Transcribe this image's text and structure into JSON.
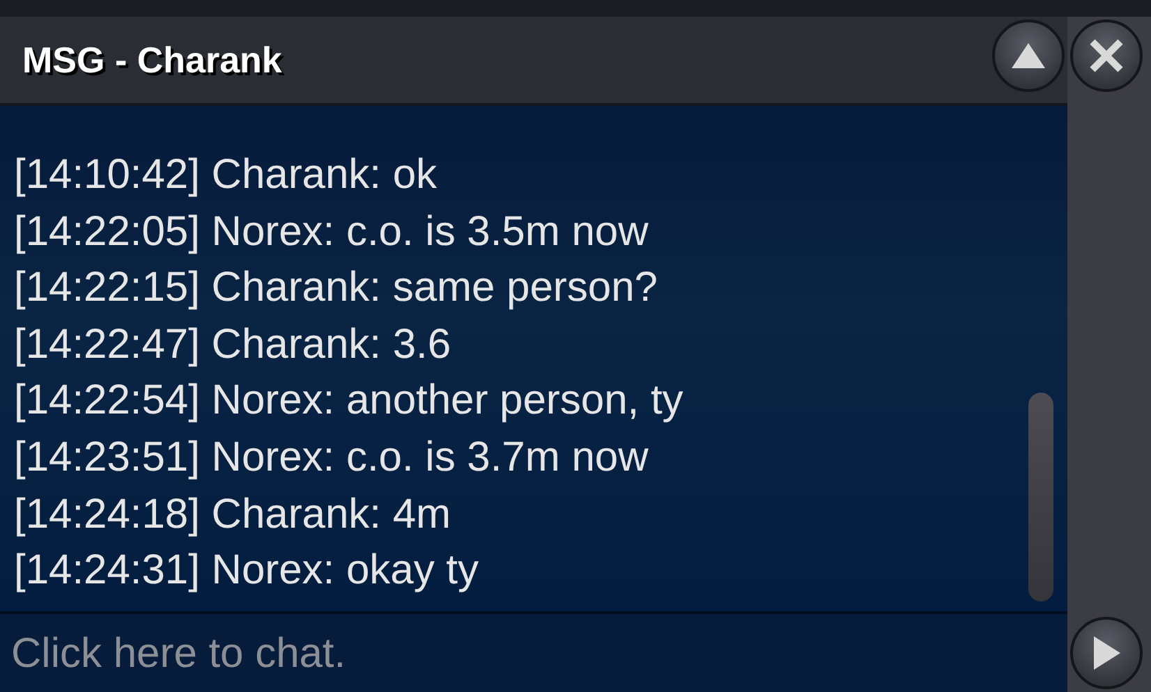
{
  "window": {
    "title": "MSG - Charank"
  },
  "messages": [
    {
      "time": "[14:10:42]",
      "text": "Charank: ok"
    },
    {
      "time": "[14:22:05]",
      "text": "Norex: c.o. is 3.5m now"
    },
    {
      "time": "[14:22:15]",
      "text": "Charank: same person?"
    },
    {
      "time": "[14:22:47]",
      "text": "Charank: 3.6"
    },
    {
      "time": "[14:22:54]",
      "text": "Norex: another person, ty"
    },
    {
      "time": "[14:23:51]",
      "text": "Norex: c.o. is 3.7m now"
    },
    {
      "time": "[14:24:18]",
      "text": "Charank: 4m"
    },
    {
      "time": "[14:24:31]",
      "text": "Norex: okay ty"
    }
  ],
  "chat_input": {
    "placeholder": "Click here to chat."
  }
}
